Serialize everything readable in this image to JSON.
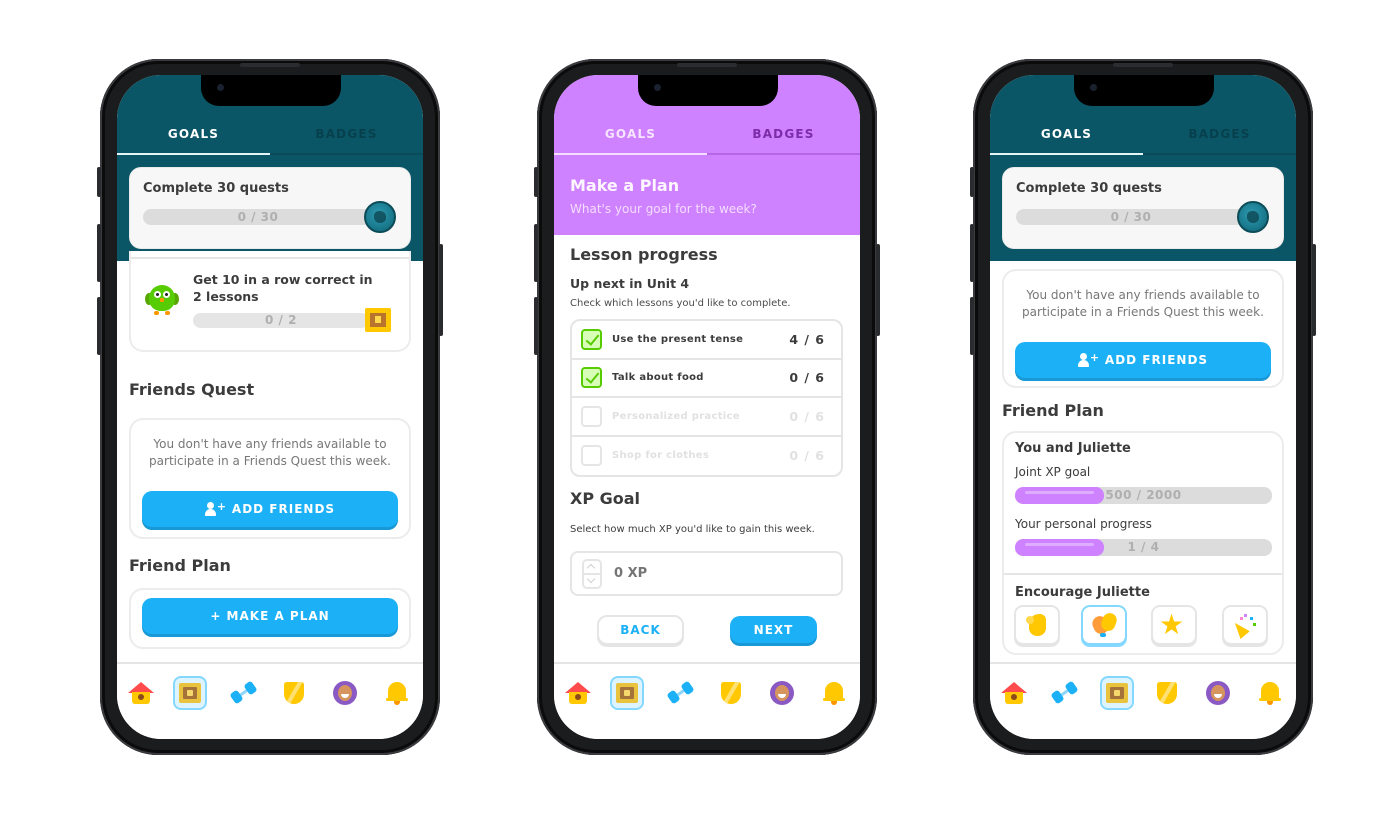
{
  "colors": {
    "teal_header": "#0b5666",
    "purple_header": "#ce82ff",
    "primary_blue": "#1cb0f6",
    "green_check": "#58cc02",
    "progress_purple": "#ce82ff"
  },
  "phones": [
    {
      "tabs": [
        {
          "label": "GOALS",
          "active": true
        },
        {
          "label": "BADGES",
          "active": false
        }
      ],
      "monthly_quest": {
        "title": "Complete 30 quests",
        "progress_label": "0 / 30",
        "progress": 0,
        "badge_icon": "monthly-badge-icon"
      },
      "quest": {
        "title": "Get 10 in a row correct in 2 lessons",
        "progress_label": "0 / 2",
        "progress": 0,
        "icon": "owl-icon",
        "reward_icon": "chest-icon"
      },
      "friends_quest": {
        "title": "Friends Quest",
        "message": "You don't have any friends available to participate in a Friends Quest this week.",
        "button_label": "ADD FRIENDS"
      },
      "friend_plan": {
        "title": "Friend Plan",
        "button_label": "+ MAKE A PLAN"
      },
      "nav": {
        "selected": "chest",
        "items": [
          "home-icon",
          "chest-icon",
          "dumbbell-icon",
          "shield-icon",
          "avatar-icon",
          "bell-icon"
        ]
      }
    },
    {
      "tabs": [
        {
          "label": "GOALS",
          "active": true
        },
        {
          "label": "BADGES",
          "active": false
        }
      ],
      "plan_header": {
        "title": "Make a Plan",
        "subtitle": "What's your goal for the week?"
      },
      "lesson_progress": {
        "title": "Lesson progress",
        "unit_title": "Up next in Unit 4",
        "instruction": "Check which lessons you'd like to complete.",
        "lessons": [
          {
            "name": "Use the present tense",
            "count": "4 / 6",
            "checked": true
          },
          {
            "name": "Talk about food",
            "count": "0 / 6",
            "checked": true
          },
          {
            "name": "Personalized practice",
            "count": "0 / 6",
            "checked": false
          },
          {
            "name": "Shop for clothes",
            "count": "0 / 6",
            "checked": false
          }
        ]
      },
      "xp_goal": {
        "title": "XP Goal",
        "instruction": "Select how much XP you'd like to gain this week.",
        "value": "0 XP"
      },
      "buttons": {
        "back": "BACK",
        "next": "NEXT"
      },
      "nav": {
        "selected": "chest",
        "items": [
          "home-icon",
          "chest-icon",
          "dumbbell-icon",
          "shield-icon",
          "avatar-icon",
          "bell-icon"
        ]
      }
    },
    {
      "tabs": [
        {
          "label": "GOALS",
          "active": true
        },
        {
          "label": "BADGES",
          "active": false
        }
      ],
      "monthly_quest": {
        "title": "Complete 30 quests",
        "progress_label": "0 / 30",
        "progress": 0
      },
      "friends_quest": {
        "message": "You don't have any friends available to participate in a Friends Quest this week.",
        "button_label": "ADD FRIENDS"
      },
      "friend_plan": {
        "title": "Friend Plan",
        "partner_title": "You and Juliette",
        "joint_label": "Joint XP goal",
        "joint_progress_label": "500 / 2000",
        "joint_progress": 0.25,
        "personal_label": "Your personal progress",
        "personal_progress_label": "1 / 4",
        "personal_progress": 0.25,
        "encourage_title": "Encourage Juliette",
        "encourage_options": [
          "flexed-biceps",
          "clapping-hands",
          "star",
          "party-popper"
        ],
        "encourage_selected": "clapping-hands"
      },
      "nav": {
        "selected": "chest",
        "items": [
          "home-icon",
          "dumbbell-icon",
          "chest-icon",
          "shield-icon",
          "avatar-icon",
          "bell-icon"
        ]
      }
    }
  ]
}
